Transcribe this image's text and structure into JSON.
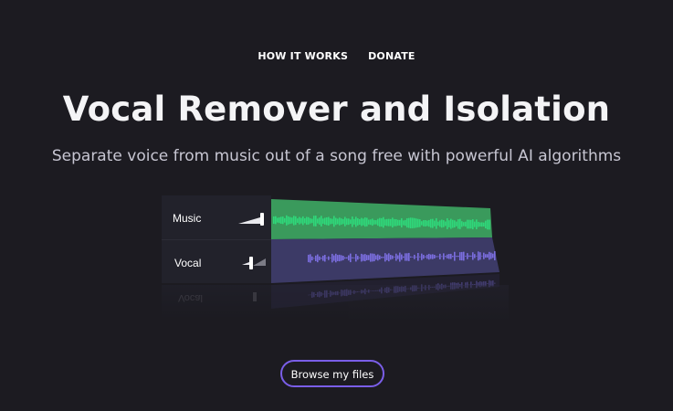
{
  "nav": {
    "items": [
      {
        "label": "HOW IT WORKS"
      },
      {
        "label": "DONATE"
      }
    ]
  },
  "hero": {
    "title": "Vocal Remover and Isolation",
    "subtitle": "Separate voice from music out of a song free with powerful AI algorithms"
  },
  "tracks": [
    {
      "label": "Music",
      "color": "#2fd87a",
      "background": "#3a9a5c"
    },
    {
      "label": "Vocal",
      "color": "#7b6ee0",
      "background": "#3c3a66"
    }
  ],
  "reflection_label": "Vocal",
  "cta": {
    "label": "Browse my files",
    "border_color": "#7a5ee8"
  },
  "colors": {
    "page_background": "#1c1b21",
    "title": "#f4f4f6",
    "subtitle": "#c7c6d2"
  }
}
